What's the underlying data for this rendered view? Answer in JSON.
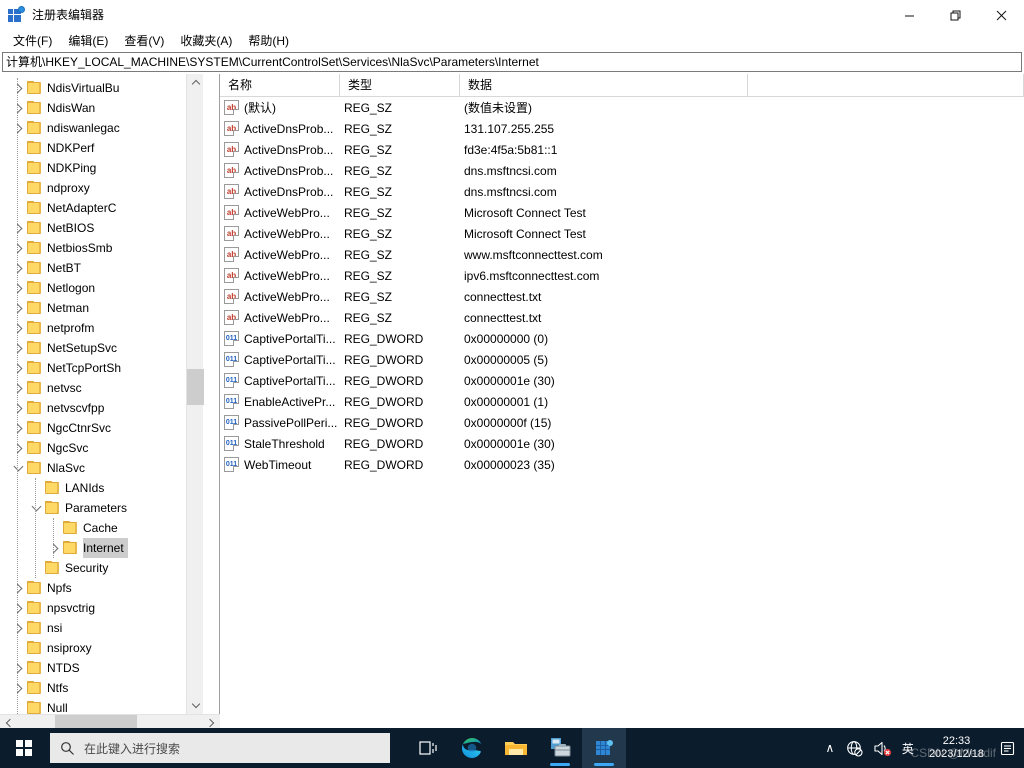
{
  "window": {
    "title": "注册表编辑器",
    "icon": "registry-editor-icon",
    "minimize": "—",
    "maximize": "❐",
    "close": "✕"
  },
  "menu": {
    "items": [
      {
        "label": "文件(F)",
        "name": "menu-file"
      },
      {
        "label": "编辑(E)",
        "name": "menu-edit"
      },
      {
        "label": "查看(V)",
        "name": "menu-view"
      },
      {
        "label": "收藏夹(A)",
        "name": "menu-favorites"
      },
      {
        "label": "帮助(H)",
        "name": "menu-help"
      }
    ]
  },
  "address": {
    "path": "计算机\\HKEY_LOCAL_MACHINE\\SYSTEM\\CurrentControlSet\\Services\\NlaSvc\\Parameters\\Internet"
  },
  "tree": {
    "nodes": [
      {
        "label": "NdisVirtualBu",
        "indent": 1,
        "state": "collapsed"
      },
      {
        "label": "NdisWan",
        "indent": 1,
        "state": "collapsed"
      },
      {
        "label": "ndiswanlegac",
        "indent": 1,
        "state": "collapsed"
      },
      {
        "label": "NDKPerf",
        "indent": 1,
        "state": "leaf"
      },
      {
        "label": "NDKPing",
        "indent": 1,
        "state": "leaf"
      },
      {
        "label": "ndproxy",
        "indent": 1,
        "state": "leaf"
      },
      {
        "label": "NetAdapterC",
        "indent": 1,
        "state": "leaf"
      },
      {
        "label": "NetBIOS",
        "indent": 1,
        "state": "collapsed"
      },
      {
        "label": "NetbiosSmb",
        "indent": 1,
        "state": "collapsed"
      },
      {
        "label": "NetBT",
        "indent": 1,
        "state": "collapsed"
      },
      {
        "label": "Netlogon",
        "indent": 1,
        "state": "collapsed"
      },
      {
        "label": "Netman",
        "indent": 1,
        "state": "collapsed"
      },
      {
        "label": "netprofm",
        "indent": 1,
        "state": "collapsed"
      },
      {
        "label": "NetSetupSvc",
        "indent": 1,
        "state": "collapsed"
      },
      {
        "label": "NetTcpPortSh",
        "indent": 1,
        "state": "collapsed"
      },
      {
        "label": "netvsc",
        "indent": 1,
        "state": "collapsed"
      },
      {
        "label": "netvscvfpp",
        "indent": 1,
        "state": "collapsed"
      },
      {
        "label": "NgcCtnrSvc",
        "indent": 1,
        "state": "collapsed"
      },
      {
        "label": "NgcSvc",
        "indent": 1,
        "state": "collapsed"
      },
      {
        "label": "NlaSvc",
        "indent": 1,
        "state": "expanded"
      },
      {
        "label": "LANIds",
        "indent": 2,
        "state": "leaf"
      },
      {
        "label": "Parameters",
        "indent": 2,
        "state": "expanded"
      },
      {
        "label": "Cache",
        "indent": 3,
        "state": "leaf"
      },
      {
        "label": "Internet",
        "indent": 3,
        "state": "collapsed",
        "selected": true
      },
      {
        "label": "Security",
        "indent": 2,
        "state": "leaf"
      },
      {
        "label": "Npfs",
        "indent": 1,
        "state": "collapsed"
      },
      {
        "label": "npsvctrig",
        "indent": 1,
        "state": "collapsed"
      },
      {
        "label": "nsi",
        "indent": 1,
        "state": "collapsed"
      },
      {
        "label": "nsiproxy",
        "indent": 1,
        "state": "leaf"
      },
      {
        "label": "NTDS",
        "indent": 1,
        "state": "collapsed"
      },
      {
        "label": "Ntfs",
        "indent": 1,
        "state": "collapsed"
      },
      {
        "label": "Null",
        "indent": 1,
        "state": "leaf"
      }
    ]
  },
  "list": {
    "columns": [
      "名称",
      "类型",
      "数据"
    ],
    "rows": [
      {
        "name": "(默认)",
        "type": "REG_SZ",
        "data": "(数值未设置)",
        "icon": "string-value-icon"
      },
      {
        "name": "ActiveDnsProb...",
        "type": "REG_SZ",
        "data": "131.107.255.255",
        "icon": "string-value-icon"
      },
      {
        "name": "ActiveDnsProb...",
        "type": "REG_SZ",
        "data": "fd3e:4f5a:5b81::1",
        "icon": "string-value-icon"
      },
      {
        "name": "ActiveDnsProb...",
        "type": "REG_SZ",
        "data": "dns.msftncsi.com",
        "icon": "string-value-icon"
      },
      {
        "name": "ActiveDnsProb...",
        "type": "REG_SZ",
        "data": "dns.msftncsi.com",
        "icon": "string-value-icon"
      },
      {
        "name": "ActiveWebPro...",
        "type": "REG_SZ",
        "data": "Microsoft Connect Test",
        "icon": "string-value-icon"
      },
      {
        "name": "ActiveWebPro...",
        "type": "REG_SZ",
        "data": "Microsoft Connect Test",
        "icon": "string-value-icon"
      },
      {
        "name": "ActiveWebPro...",
        "type": "REG_SZ",
        "data": "www.msftconnecttest.com",
        "icon": "string-value-icon"
      },
      {
        "name": "ActiveWebPro...",
        "type": "REG_SZ",
        "data": "ipv6.msftconnecttest.com",
        "icon": "string-value-icon"
      },
      {
        "name": "ActiveWebPro...",
        "type": "REG_SZ",
        "data": "connecttest.txt",
        "icon": "string-value-icon"
      },
      {
        "name": "ActiveWebPro...",
        "type": "REG_SZ",
        "data": "connecttest.txt",
        "icon": "string-value-icon"
      },
      {
        "name": "CaptivePortalTi...",
        "type": "REG_DWORD",
        "data": "0x00000000 (0)",
        "icon": "dword-value-icon"
      },
      {
        "name": "CaptivePortalTi...",
        "type": "REG_DWORD",
        "data": "0x00000005 (5)",
        "icon": "dword-value-icon"
      },
      {
        "name": "CaptivePortalTi...",
        "type": "REG_DWORD",
        "data": "0x0000001e (30)",
        "icon": "dword-value-icon"
      },
      {
        "name": "EnableActivePr...",
        "type": "REG_DWORD",
        "data": "0x00000001 (1)",
        "icon": "dword-value-icon"
      },
      {
        "name": "PassivePollPeri...",
        "type": "REG_DWORD",
        "data": "0x0000000f (15)",
        "icon": "dword-value-icon"
      },
      {
        "name": "StaleThreshold",
        "type": "REG_DWORD",
        "data": "0x0000001e (30)",
        "icon": "dword-value-icon"
      },
      {
        "name": "WebTimeout",
        "type": "REG_DWORD",
        "data": "0x00000023 (35)",
        "icon": "dword-value-icon"
      }
    ]
  },
  "taskbar": {
    "start": "start-button",
    "search_placeholder": "在此键入进行搜索",
    "apps": [
      {
        "name": "task-view-button",
        "label": ""
      },
      {
        "name": "microsoft-edge-button",
        "label": ""
      },
      {
        "name": "file-explorer-button",
        "label": ""
      },
      {
        "name": "tool-app-button",
        "label": ""
      },
      {
        "name": "registry-editor-button",
        "label": ""
      }
    ],
    "tray": {
      "chevron": "∧",
      "network_icon": "network-globe-icon",
      "volume_icon": "volume-muted-icon",
      "ime": "英",
      "time": "22:33",
      "date": "2023/12/18",
      "notification_icon": "notifications-icon"
    },
    "watermark": "CSDN @Meadif"
  },
  "colors": {
    "taskbar_bg": "#0b1c2c",
    "accent": "#3da8f5",
    "folder": "#ffd966",
    "selection": "#cdcdcd",
    "string_icon": "#c0392b",
    "dword_icon": "#1f5fbf"
  }
}
